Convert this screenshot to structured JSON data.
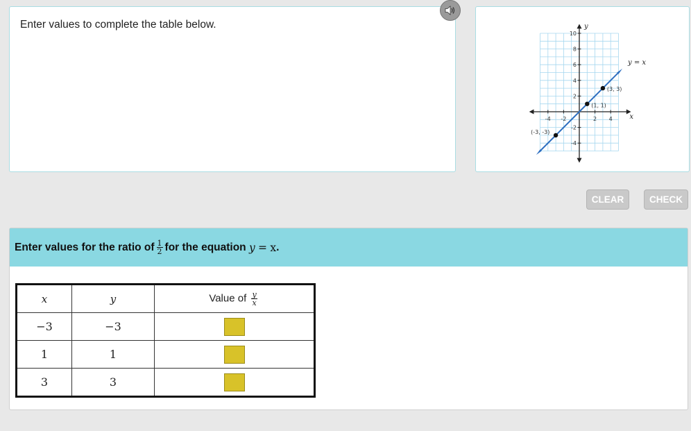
{
  "prompt": {
    "text": "Enter values to complete the table below."
  },
  "buttons": {
    "clear": "CLEAR",
    "check": "CHECK"
  },
  "graph": {
    "x_ticks": [
      "-4",
      "-2",
      "2",
      "4"
    ],
    "y_ticks": [
      "10",
      "8",
      "6",
      "4",
      "2",
      "-2",
      "-4"
    ],
    "x_axis_label": "x",
    "y_axis_label": "y",
    "line_label": "y = x",
    "points": [
      {
        "label": "(-3, -3)",
        "x": -3,
        "y": -3
      },
      {
        "label": "(1, 1)",
        "x": 1,
        "y": 1
      },
      {
        "label": "(3, 3)",
        "x": 3,
        "y": 3
      }
    ],
    "line_color": "#2e6fc0"
  },
  "question": {
    "prefix": "Enter values for the ratio of",
    "fraction_num": "1",
    "fraction_den": "2",
    "middle": "for the equation",
    "eq_lhs": "y",
    "eq_op": "=",
    "eq_rhs": "x",
    "suffix": "."
  },
  "table": {
    "header_x": "x",
    "header_y": "y",
    "header_value_prefix": "Value of",
    "header_value_num": "y",
    "header_value_den": "x",
    "rows": [
      {
        "x": "−3",
        "y": "−3"
      },
      {
        "x": "1",
        "y": "1"
      },
      {
        "x": "3",
        "y": "3"
      }
    ]
  },
  "colors": {
    "header_bg": "#8ad8e2",
    "answer_box": "#d8c229",
    "button_disabled": "#c9c9c9"
  }
}
